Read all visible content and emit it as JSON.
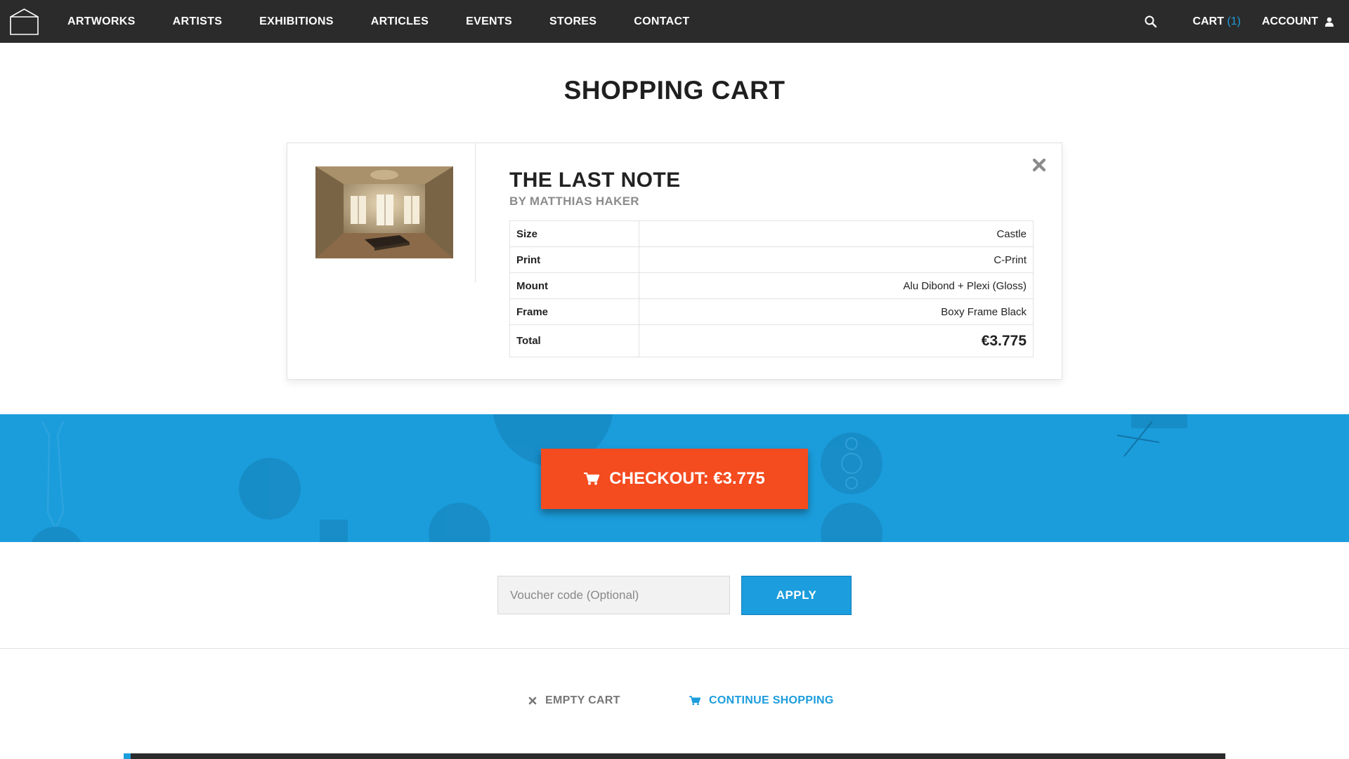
{
  "nav": {
    "logo_icon": "gallery-box-logo",
    "links": [
      "ARTWORKS",
      "ARTISTS",
      "EXHIBITIONS",
      "ARTICLES",
      "EVENTS",
      "STORES",
      "CONTACT"
    ],
    "search_icon": "search-icon",
    "cart_label": "CART",
    "cart_count": "(1)",
    "account_label": "ACCOUNT",
    "account_icon": "user-icon"
  },
  "page": {
    "title": "SHOPPING CART"
  },
  "cart_item": {
    "title": "THE LAST NOTE",
    "artist": "BY MATTHIAS HAKER",
    "specs": [
      {
        "key": "Size",
        "value": "Castle"
      },
      {
        "key": "Print",
        "value": "C-Print"
      },
      {
        "key": "Mount",
        "value": "Alu Dibond + Plexi (Gloss)"
      },
      {
        "key": "Frame",
        "value": "Boxy Frame Black"
      }
    ],
    "total_label": "Total",
    "total_value": "€3.775",
    "remove_icon": "close-icon"
  },
  "checkout": {
    "label": "CHECKOUT: €3.775",
    "icon": "cart-icon"
  },
  "voucher": {
    "placeholder": "Voucher code (Optional)",
    "value": "",
    "apply_label": "APPLY"
  },
  "actions": {
    "empty_cart_label": "EMPTY CART",
    "continue_label": "CONTINUE SHOPPING"
  },
  "colors": {
    "nav_bg": "#2b2b2b",
    "accent_blue": "#1c9ddd",
    "checkout_orange": "#f44b1f"
  }
}
